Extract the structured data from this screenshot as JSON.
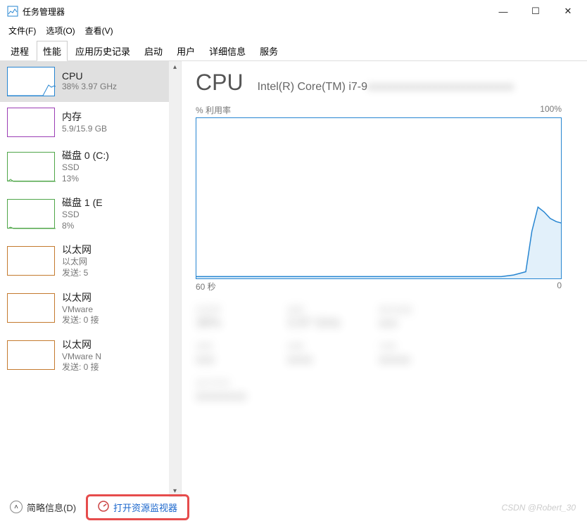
{
  "window": {
    "title": "任务管理器",
    "controls": {
      "min": "—",
      "max": "☐",
      "close": "✕"
    }
  },
  "menu": {
    "file": "文件(F)",
    "options": "选项(O)",
    "view": "查看(V)"
  },
  "tabs": {
    "processes": "进程",
    "performance": "性能",
    "app_history": "应用历史记录",
    "startup": "启动",
    "users": "用户",
    "details": "详细信息",
    "services": "服务"
  },
  "sidebar": {
    "cpu": {
      "title": "CPU",
      "sub": "38% 3.97 GHz"
    },
    "memory": {
      "title": "内存",
      "sub": "5.9/15.9 GB"
    },
    "disk0": {
      "title": "磁盘 0 (C:)",
      "type": "SSD",
      "usage": "13%"
    },
    "disk1": {
      "title": "磁盘 1 (E",
      "type": "SSD",
      "usage": "8%"
    },
    "eth0": {
      "title": "以太网",
      "name": "以太网",
      "tx": "发送: 5"
    },
    "eth1": {
      "title": "以太网",
      "name": "VMware",
      "tx": "发送: 0 接"
    },
    "eth2": {
      "title": "以太网",
      "name": "VMware N",
      "tx": "发送: 0 接"
    }
  },
  "main": {
    "title": "CPU",
    "model_visible": "Intel(R) Core(TM) i7-9",
    "util_label": "% 利用率",
    "util_max": "100%",
    "time_left": "60 秒",
    "time_right": "0"
  },
  "chart_data": {
    "type": "line",
    "title": "% 利用率",
    "xlabel": "60 秒",
    "ylabel": "",
    "ylim": [
      0,
      100
    ],
    "xlim": [
      60,
      0
    ],
    "series": [
      {
        "name": "CPU 利用率",
        "x": [
          60,
          55,
          50,
          45,
          40,
          35,
          30,
          25,
          20,
          15,
          10,
          8,
          6,
          5,
          4,
          3,
          2,
          1,
          0
        ],
        "values": [
          2,
          2,
          2,
          2,
          2,
          2,
          2,
          2,
          2,
          2,
          2,
          3,
          5,
          30,
          45,
          42,
          38,
          36,
          35
        ]
      }
    ]
  },
  "bottom": {
    "brief": "简略信息(D)",
    "resource_monitor": "打开资源监视器"
  },
  "watermark": "CSDN @Robert_30"
}
